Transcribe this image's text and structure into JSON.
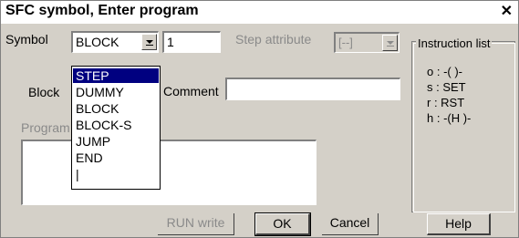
{
  "window": {
    "title": "SFC symbol, Enter program",
    "close_glyph": "✕"
  },
  "symbol": {
    "label": "Symbol",
    "selected": "BLOCK",
    "number_value": "1"
  },
  "step_attribute": {
    "label": "Step attribute",
    "value": "[--]"
  },
  "block": {
    "label": "Block"
  },
  "comment": {
    "label": "Comment",
    "value": ""
  },
  "program": {
    "label": "Program"
  },
  "dropdown": {
    "items": [
      "STEP",
      "DUMMY",
      "BLOCK",
      "BLOCK-S",
      "JUMP",
      "END",
      "|"
    ],
    "highlighted": "STEP"
  },
  "instruction_list": {
    "title": "Instruction list",
    "lines": [
      "o : -( )-",
      "s : SET",
      "r : RST",
      "h : -(H )-"
    ]
  },
  "buttons": {
    "run_write": "RUN write",
    "ok": "OK",
    "cancel": "Cancel",
    "help": "Help"
  },
  "colors": {
    "dialog_bg": "#d4d0c8",
    "highlight": "#000080",
    "disabled_text": "#8a8a8a"
  }
}
